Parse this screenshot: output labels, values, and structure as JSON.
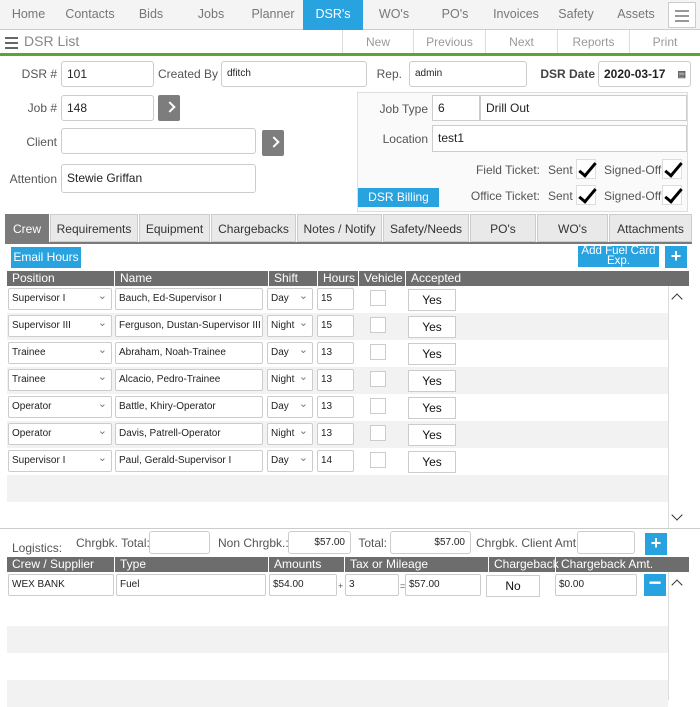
{
  "nav": {
    "items": [
      "Home",
      "Contacts",
      "Bids",
      "Jobs",
      "Planner",
      "DSR's",
      "WO's",
      "PO's",
      "Invoices",
      "Safety",
      "Assets"
    ],
    "active": "DSR's"
  },
  "subbar": {
    "title": "DSR List",
    "buttons": [
      "New",
      "Previous",
      "Next",
      "Reports",
      "Print"
    ]
  },
  "form": {
    "dsr_label": "DSR #",
    "dsr_value": "101",
    "created_by_label": "Created By",
    "created_by_value": "dfitch",
    "rep_label": "Rep.",
    "rep_value": "admin",
    "dsr_date_label": "DSR Date",
    "dsr_date_value": "2020-03-17",
    "job_label": "Job #",
    "job_value": "148",
    "client_label": "Client",
    "client_value": "",
    "attention_label": "Attention",
    "attention_value": "Stewie Griffan",
    "job_type_label": "Job Type",
    "job_type_code": "6",
    "job_type_name": "Drill Out",
    "location_label": "Location",
    "location_value": "test1",
    "field_ticket_label": "Field Ticket:",
    "office_ticket_label": "Office Ticket:",
    "sent_label": "Sent",
    "signed_off_label": "Signed-Off",
    "billing_button": "DSR Billing"
  },
  "tabs": [
    "Crew",
    "Requirements",
    "Equipment",
    "Chargebacks",
    "Notes / Notify",
    "Safety/Needs",
    "PO's",
    "WO's",
    "Attachments"
  ],
  "crew": {
    "email_hours": "Email Hours",
    "add_fuel": "Add Fuel Card Exp.",
    "headers": [
      "Position",
      "Name",
      "Shift",
      "Hours",
      "Vehicle",
      "Accepted"
    ],
    "rows": [
      {
        "position": "Supervisor I",
        "name": "Bauch, Ed-Supervisor I",
        "shift": "Day",
        "hours": "15",
        "accepted": "Yes"
      },
      {
        "position": "Supervisor III",
        "name": "Ferguson, Dustan-Supervisor III",
        "shift": "Night",
        "hours": "15",
        "accepted": "Yes"
      },
      {
        "position": "Trainee",
        "name": "Abraham, Noah-Trainee",
        "shift": "Day",
        "hours": "13",
        "accepted": "Yes"
      },
      {
        "position": "Trainee",
        "name": "Alcacio, Pedro-Trainee",
        "shift": "Night",
        "hours": "13",
        "accepted": "Yes"
      },
      {
        "position": "Operator",
        "name": "Battle, Khiry-Operator",
        "shift": "Day",
        "hours": "13",
        "accepted": "Yes"
      },
      {
        "position": "Operator",
        "name": "Davis, Patrell-Operator",
        "shift": "Night",
        "hours": "13",
        "accepted": "Yes"
      },
      {
        "position": "Supervisor I",
        "name": "Paul, Gerald-Supervisor I",
        "shift": "Day",
        "hours": "14",
        "accepted": "Yes"
      }
    ]
  },
  "logistics": {
    "label": "Logistics:",
    "chrgbk_total_label": "Chrgbk. Total:",
    "chrgbk_total_value": "",
    "non_chrgbk_label": "Non Chrgbk.:",
    "non_chrgbk_value": "$57.00",
    "total_label": "Total:",
    "total_value": "$57.00",
    "client_amt_label": "Chrgbk. Client Amt.:",
    "client_amt_value": ""
  },
  "fuel": {
    "headers": [
      "Crew / Supplier",
      "Type",
      "Amounts",
      "Tax or Mileage",
      "Chargeback",
      "Chargeback Amt."
    ],
    "rows": [
      {
        "supplier": "WEX BANK",
        "type": "Fuel",
        "amount": "$54.00",
        "plus": "+",
        "tax": "3",
        "equals": "=",
        "total": "$57.00",
        "chargeback": "No",
        "chargeback_amt": "$0.00"
      }
    ]
  }
}
